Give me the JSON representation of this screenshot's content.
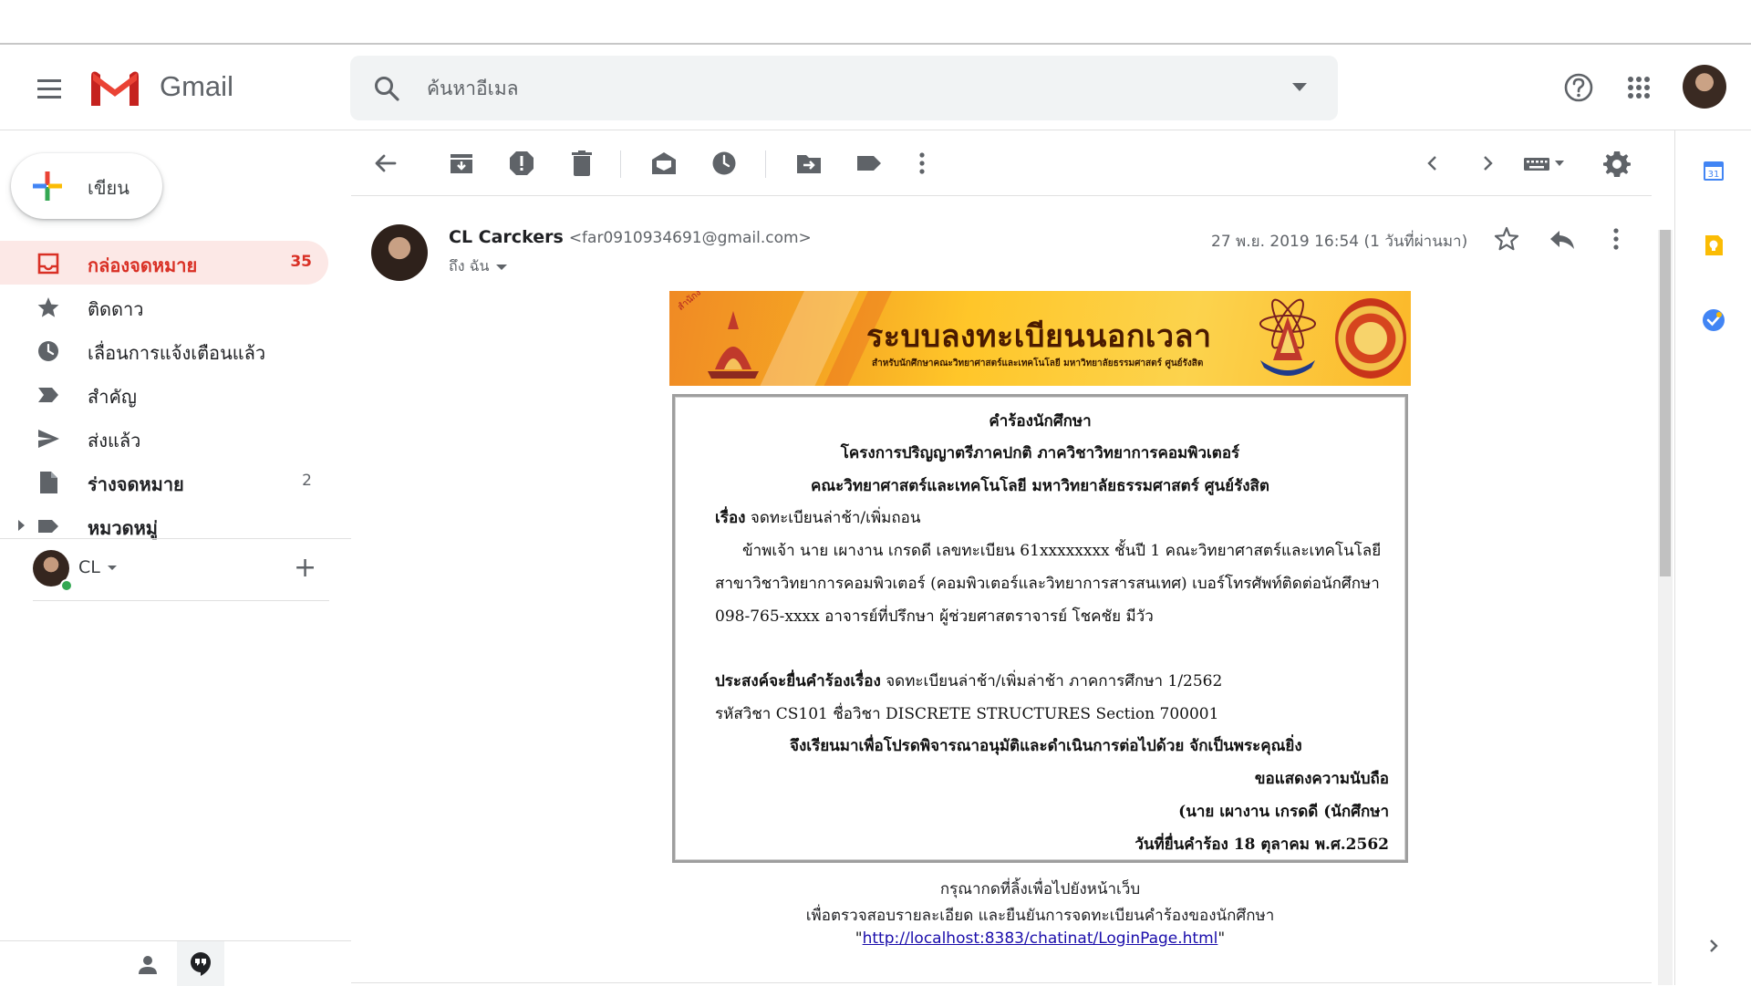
{
  "app": {
    "name": "Gmail"
  },
  "search": {
    "placeholder": "ค้นหาอีเมล"
  },
  "compose": {
    "label": "เขียน"
  },
  "nav": {
    "items": [
      {
        "label": "กล่องจดหมาย",
        "count": "35"
      },
      {
        "label": "ติดดาว",
        "count": ""
      },
      {
        "label": "เลื่อนการแจ้งเตือนแล้ว",
        "count": ""
      },
      {
        "label": "สำคัญ",
        "count": ""
      },
      {
        "label": "ส่งแล้ว",
        "count": ""
      },
      {
        "label": "ร่างจดหมาย",
        "count": "2"
      },
      {
        "label": "หมวดหมู่",
        "count": ""
      }
    ]
  },
  "hangouts": {
    "user": "CL"
  },
  "message": {
    "sender_name": "CL Carckers",
    "sender_email": "<far0910934691@gmail.com>",
    "to": "ถึง ฉัน",
    "date": "27 พ.ย. 2019 16:54 (1 วันที่ผ่านมา)"
  },
  "banner": {
    "title": "ระบบลงทะเบียนนอกเวลา",
    "subtitle": "สำหรับนักศึกษาคณะวิทยาศาสตร์และเทคโนโลยี มหาวิทยาลัยธรรมศาสตร์ ศูนย์รังสิต",
    "arc_text": "สำนักงานทะเบียนนักศึกษา มธ"
  },
  "form": {
    "heading1": "คำร้องนักศึกษา",
    "heading2": "โครงการปริญญาตรีภาคปกติ ภาควิชาวิทยาการคอมพิวเตอร์",
    "heading3": "คณะวิทยาศาสตร์และเทคโนโลยี มหาวิทยาลัยธรรมศาสตร์ ศูนย์รังสิต",
    "subject_label": "เรื่อง",
    "subject": "จดทะเบียนล่าช้า/เพิ่มถอน",
    "body1": "ข้าพเจ้า นาย เผางาน เกรดดี เลขทะเบียน 61xxxxxxxx ชั้นปี 1 คณะวิทยาศาสตร์และเทคโนโลยี",
    "body2": "สาขาวิชาวิทยาการคอมพิวเตอร์ (คอมพิวเตอร์และวิทยาการสารสนเทศ) เบอร์โทรศัพท์ติดต่อนักศึกษา",
    "body3": "098-765-xxxx อาจารย์ที่ปรึกษา ผู้ช่วยศาสตราจารย์ โชคชัย มีวัว",
    "request_label": "ประสงค์จะยื่นคำร้องเรื่อง",
    "request": "จดทะเบียนล่าช้า/เพิ่มล่าช้า ภาคการศึกษา 1/2562",
    "course": "รหัสวิชา CS101 ชื่อวิชา DISCRETE STRUCTURES Section 700001",
    "closing": "จึงเรียนมาเพื่อโปรดพิจารณาอนุมัติและดำเนินการต่อไปด้วย จักเป็นพระคุณยิ่ง",
    "regards": "ขอแสดงความนับถือ",
    "signature": "(นาย เผางาน เกรดดี (นักศึกษา",
    "date_line": "วันที่ยื่นคำร้อง 18 ตุลาคม พ.ศ.2562"
  },
  "footer": {
    "line1": "กรุณากดที่ลิ้งเพื่อไปยังหน้าเว็บ",
    "line2": "เพื่อตรวจสอบรายละเอียด และยืนยันการจดทะเบียนคำร้องของนักศึกษา",
    "quote_open": "\"",
    "link": "http://localhost:8383/chatinat/LoginPage.html",
    "quote_close": "\""
  },
  "side_panel": {
    "calendar_day": "31"
  },
  "colors": {
    "accent_red": "#d93025",
    "active_bg": "#fce8e6",
    "link": "#1a0dab"
  }
}
